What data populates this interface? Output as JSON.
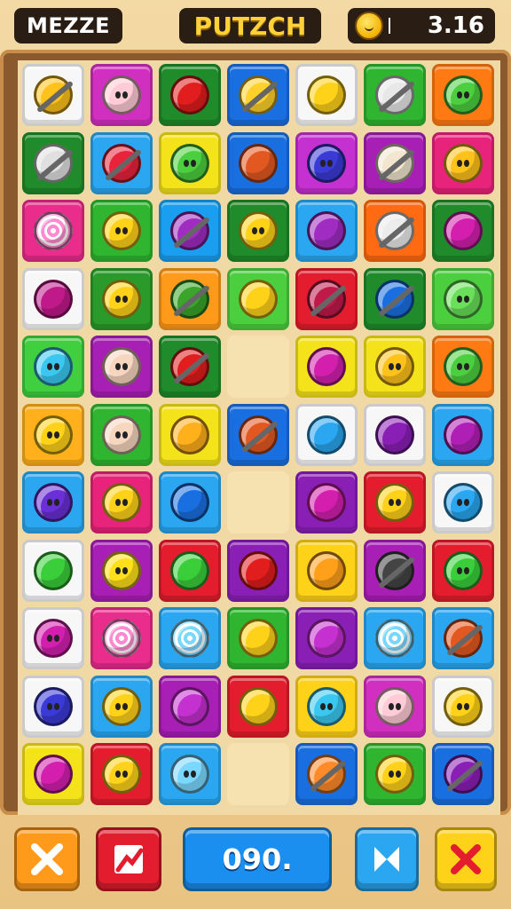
{
  "header": {
    "left_label": "MEZZE",
    "title": "PUTZCH",
    "score": "3.16",
    "coin_icon": "coin-face-icon"
  },
  "board": {
    "rows": [
      [
        {
          "bg": "#f7f7f7",
          "fg": "#ffc21a",
          "shape": "stick",
          "icon": "candy-stick-icon"
        },
        {
          "bg": "#d12fc0",
          "fg": "#ffcbd6",
          "shape": "face",
          "icon": "pig-face-icon"
        },
        {
          "bg": "#1f8b2a",
          "fg": "#e11d1d",
          "shape": "plain",
          "icon": "apple-icon"
        },
        {
          "bg": "#1a6fe0",
          "fg": "#ffd12a",
          "shape": "stick",
          "icon": "corn-icon"
        },
        {
          "bg": "#f7f7f7",
          "fg": "#ffd21a",
          "shape": "plain",
          "icon": "yellow-ball-icon"
        },
        {
          "bg": "#2fb52f",
          "fg": "#e8e8e8",
          "shape": "stick",
          "icon": "music-note-icon"
        },
        {
          "bg": "#ff7a12",
          "fg": "#4ccf3f",
          "shape": "face",
          "icon": "green-smiley-icon"
        }
      ],
      [
        {
          "bg": "#1f8b2a",
          "fg": "#e0e0e0",
          "shape": "stick",
          "icon": "map-tile-icon"
        },
        {
          "bg": "#2aa7f0",
          "fg": "#e8233b",
          "shape": "stick",
          "icon": "candy-stick-icon"
        },
        {
          "bg": "#f4e21a",
          "fg": "#4ccf3f",
          "shape": "face",
          "icon": "green-smiley-icon"
        },
        {
          "bg": "#1a6fe0",
          "fg": "#e25820",
          "shape": "plain",
          "icon": "berry-icon"
        },
        {
          "bg": "#c530d0",
          "fg": "#3a3ad6",
          "shape": "face",
          "icon": "blue-smiley-icon"
        },
        {
          "bg": "#a71fb5",
          "fg": "#f2e6d0",
          "shape": "stick",
          "icon": "mallet-icon"
        },
        {
          "bg": "#e8237b",
          "fg": "#ffc21a",
          "shape": "face",
          "icon": "yellow-smiley-icon"
        }
      ],
      [
        {
          "bg": "#ea2c8c",
          "fg": "#ff8ad0",
          "shape": "swirl",
          "icon": "swirl-candy-icon"
        },
        {
          "bg": "#2fb52f",
          "fg": "#ffd21a",
          "shape": "face",
          "icon": "lemon-face-icon"
        },
        {
          "bg": "#1a9ff0",
          "fg": "#a02cc2",
          "shape": "stick",
          "icon": "grape-stick-icon"
        },
        {
          "bg": "#1f8b2a",
          "fg": "#ffd21a",
          "shape": "face",
          "icon": "chick-face-icon"
        },
        {
          "bg": "#2aa7f0",
          "fg": "#a02cc2",
          "shape": "plain",
          "icon": "plum-icon"
        },
        {
          "bg": "#ff6a12",
          "fg": "#ececec",
          "shape": "stick",
          "icon": "shell-icon"
        },
        {
          "bg": "#1f8b2a",
          "fg": "#d41fae",
          "shape": "plain",
          "icon": "berry-icon"
        }
      ],
      [
        {
          "bg": "#f7f7f7",
          "fg": "#c01a8a",
          "shape": "plain",
          "icon": "plum-icon"
        },
        {
          "bg": "#2a9b2a",
          "fg": "#ffd21a",
          "shape": "face",
          "icon": "cat-face-icon"
        },
        {
          "bg": "#ff9a1a",
          "fg": "#3aa52a",
          "shape": "stick",
          "icon": "leaf-stick-icon"
        },
        {
          "bg": "#4ccf3f",
          "fg": "#ffd21a",
          "shape": "plain",
          "icon": "banana-icon"
        },
        {
          "bg": "#e31d2d",
          "fg": "#c01a4a",
          "shape": "stick",
          "icon": "bow-icon"
        },
        {
          "bg": "#1f8b2a",
          "fg": "#1a6fe0",
          "shape": "stick",
          "icon": "brush-icon"
        },
        {
          "bg": "#4ccf3f",
          "fg": "#6ae05a",
          "shape": "face",
          "icon": "green-cat-icon"
        }
      ],
      [
        {
          "bg": "#3fcf3f",
          "fg": "#3ac8f0",
          "shape": "face",
          "icon": "blue-ball-icon"
        },
        {
          "bg": "#a71fb5",
          "fg": "#f7d6c0",
          "shape": "face",
          "icon": "hamster-face-icon"
        },
        {
          "bg": "#1f8b2a",
          "fg": "#e11d1d",
          "shape": "stick",
          "icon": "pepper-icon"
        },
        {
          "bg": "empty",
          "fg": "none",
          "shape": "none",
          "icon": ""
        },
        {
          "bg": "#f4e21a",
          "fg": "#d41fae",
          "shape": "plain",
          "icon": "pink-ball-icon"
        },
        {
          "bg": "#f4e21a",
          "fg": "#ffc21a",
          "shape": "face",
          "icon": "chick-face-icon"
        },
        {
          "bg": "#ff7a12",
          "fg": "#4ccf3f",
          "shape": "face",
          "icon": "green-smiley-icon"
        }
      ],
      [
        {
          "bg": "#ffb01a",
          "fg": "#ffd21a",
          "shape": "face",
          "icon": "cat-face-icon"
        },
        {
          "bg": "#2fb52f",
          "fg": "#f7d6c0",
          "shape": "face",
          "icon": "hamster-face-icon"
        },
        {
          "bg": "#f4e21a",
          "fg": "#ffb01a",
          "shape": "plain",
          "icon": "orange-ball-icon"
        },
        {
          "bg": "#1a6fe0",
          "fg": "#e25820",
          "shape": "stick",
          "icon": "pretzel-icon"
        },
        {
          "bg": "#f7f7f7",
          "fg": "#2aa7f0",
          "shape": "plain",
          "icon": "blue-ball-icon"
        },
        {
          "bg": "#f7f7f7",
          "fg": "#8a1fb5",
          "shape": "plain",
          "icon": "grape-icon"
        },
        {
          "bg": "#2aa7f0",
          "fg": "#b01fb5",
          "shape": "plain",
          "icon": "candy-icon"
        }
      ],
      [
        {
          "bg": "#2aa7f0",
          "fg": "#6a2fd6",
          "shape": "face",
          "icon": "purple-smiley-icon"
        },
        {
          "bg": "#e8237b",
          "fg": "#ffd21a",
          "shape": "face",
          "icon": "cat-face-icon"
        },
        {
          "bg": "#2aa7f0",
          "fg": "#1a6fe0",
          "shape": "plain",
          "icon": "blue-ball-icon"
        },
        {
          "bg": "empty",
          "fg": "none",
          "shape": "none",
          "icon": ""
        },
        {
          "bg": "#8a1fb5",
          "fg": "#d41fae",
          "shape": "plain",
          "icon": "plum-icon"
        },
        {
          "bg": "#e31d2d",
          "fg": "#ffd21a",
          "shape": "face",
          "icon": "cat-face-icon"
        },
        {
          "bg": "#f7f7f7",
          "fg": "#2aa7f0",
          "shape": "face",
          "icon": "blue-blob-icon"
        }
      ],
      [
        {
          "bg": "#f7f7f7",
          "fg": "#3acf3a",
          "shape": "plain",
          "icon": "green-ball-icon"
        },
        {
          "bg": "#a71fb5",
          "fg": "#ffe01a",
          "shape": "face",
          "icon": "owl-face-icon"
        },
        {
          "bg": "#e31d2d",
          "fg": "#3acf3a",
          "shape": "plain",
          "icon": "lime-icon"
        },
        {
          "bg": "#8a1fb5",
          "fg": "#e11d1d",
          "shape": "plain",
          "icon": "cherry-icon"
        },
        {
          "bg": "#ffd21a",
          "fg": "#ffa01a",
          "shape": "plain",
          "icon": "orange-ball-icon"
        },
        {
          "bg": "#a71fb5",
          "fg": "#444444",
          "shape": "stick",
          "icon": "pin-icon"
        },
        {
          "bg": "#e31d2d",
          "fg": "#3acf3a",
          "shape": "face",
          "icon": "green-smiley-icon"
        }
      ],
      [
        {
          "bg": "#f7f7f7",
          "fg": "#d41fae",
          "shape": "face",
          "icon": "pink-cat-icon"
        },
        {
          "bg": "#ea2c8c",
          "fg": "#ff8ad0",
          "shape": "swirl",
          "icon": "swirl-candy-icon"
        },
        {
          "bg": "#2aa7f0",
          "fg": "#7ad8ff",
          "shape": "swirl",
          "icon": "swirl-candy-icon"
        },
        {
          "bg": "#2fb52f",
          "fg": "#ffd21a",
          "shape": "plain",
          "icon": "mango-icon"
        },
        {
          "bg": "#8a1fb5",
          "fg": "#c530d0",
          "shape": "plain",
          "icon": "plum-icon"
        },
        {
          "bg": "#2aa7f0",
          "fg": "#7ad8ff",
          "shape": "swirl",
          "icon": "swirl-candy-icon"
        },
        {
          "bg": "#2aa7f0",
          "fg": "#e25820",
          "shape": "stick",
          "icon": "flower-icon"
        }
      ],
      [
        {
          "bg": "#f7f7f7",
          "fg": "#3a3ad6",
          "shape": "face",
          "icon": "blue-smiley-icon"
        },
        {
          "bg": "#2aa7f0",
          "fg": "#ffd21a",
          "shape": "face",
          "icon": "cat-face-icon"
        },
        {
          "bg": "#a71fb5",
          "fg": "#c530d0",
          "shape": "plain",
          "icon": "plum-icon"
        },
        {
          "bg": "#e31d2d",
          "fg": "#ffd21a",
          "shape": "plain",
          "icon": "lemon-icon"
        },
        {
          "bg": "#ffd21a",
          "fg": "#3ac8f0",
          "shape": "face",
          "icon": "blue-blob-icon"
        },
        {
          "bg": "#d12fc0",
          "fg": "#ffcbd6",
          "shape": "face",
          "icon": "pig-face-icon"
        },
        {
          "bg": "#f7f7f7",
          "fg": "#ffd21a",
          "shape": "face",
          "icon": "yellow-smiley-icon"
        }
      ],
      [
        {
          "bg": "#f4e21a",
          "fg": "#d41fae",
          "shape": "plain",
          "icon": "pink-ball-icon"
        },
        {
          "bg": "#e31d2d",
          "fg": "#ffd21a",
          "shape": "face",
          "icon": "cat-face-icon"
        },
        {
          "bg": "#2aa7f0",
          "fg": "#7ad8ff",
          "shape": "face",
          "icon": "blue-ball-icon"
        },
        {
          "bg": "empty",
          "fg": "none",
          "shape": "none",
          "icon": ""
        },
        {
          "bg": "#1a6fe0",
          "fg": "#ff8a2a",
          "shape": "stick",
          "icon": "onion-icon"
        },
        {
          "bg": "#2fb52f",
          "fg": "#ffd21a",
          "shape": "face",
          "icon": "cat-face-icon"
        },
        {
          "bg": "#1a6fe0",
          "fg": "#8a1fb5",
          "shape": "stick",
          "icon": "eggplant-icon"
        }
      ]
    ]
  },
  "footer": {
    "close_button_icon": "close-x-icon",
    "stats_button_icon": "chart-icon",
    "counter_value": "090.",
    "shuffle_button_icon": "bowtie-icon",
    "cancel_button_icon": "red-x-icon",
    "colors": {
      "close": "#ff9a1a",
      "stats": "#e31d2d",
      "counter": "#1a8ff0",
      "shuffle": "#2aa7f0",
      "cancel": "#ffd21a"
    }
  }
}
